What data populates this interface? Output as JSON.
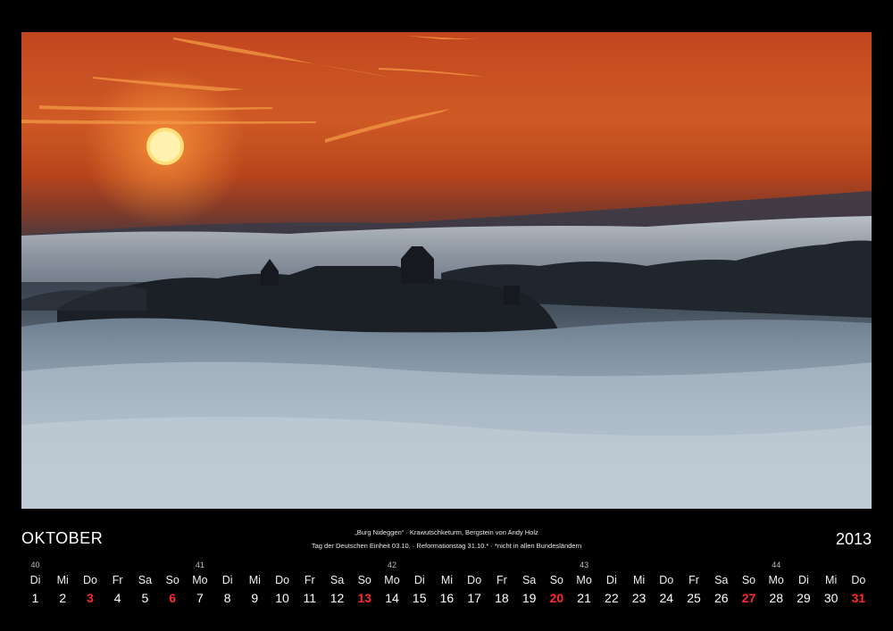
{
  "header": {
    "month": "OKTOBER",
    "year": "2013",
    "caption_line1": "„Burg Nideggen“ · Krawutschketurm, Bergstein von Andy Holz",
    "caption_line2": "Tag der Deutschen Einheit 03.10. · Reformationstag 31.10.* · *nicht in allen Bundesländern"
  },
  "photo": {
    "subject": "Burg Nideggen über dem Nebel bei Sonnenaufgang"
  },
  "colors": {
    "holiday": "#ff2a2a",
    "background": "#000000"
  },
  "calendar": {
    "weeks": [
      {
        "label": "40",
        "at_day": 0
      },
      {
        "label": "41",
        "at_day": 6
      },
      {
        "label": "42",
        "at_day": 13
      },
      {
        "label": "43",
        "at_day": 20
      },
      {
        "label": "44",
        "at_day": 27
      }
    ],
    "days": [
      {
        "name": "Di",
        "num": "1",
        "red": false
      },
      {
        "name": "Mi",
        "num": "2",
        "red": false
      },
      {
        "name": "Do",
        "num": "3",
        "red": true
      },
      {
        "name": "Fr",
        "num": "4",
        "red": false
      },
      {
        "name": "Sa",
        "num": "5",
        "red": false
      },
      {
        "name": "So",
        "num": "6",
        "red": true
      },
      {
        "name": "Mo",
        "num": "7",
        "red": false
      },
      {
        "name": "Di",
        "num": "8",
        "red": false
      },
      {
        "name": "Mi",
        "num": "9",
        "red": false
      },
      {
        "name": "Do",
        "num": "10",
        "red": false
      },
      {
        "name": "Fr",
        "num": "11",
        "red": false
      },
      {
        "name": "Sa",
        "num": "12",
        "red": false
      },
      {
        "name": "So",
        "num": "13",
        "red": true
      },
      {
        "name": "Mo",
        "num": "14",
        "red": false
      },
      {
        "name": "Di",
        "num": "15",
        "red": false
      },
      {
        "name": "Mi",
        "num": "16",
        "red": false
      },
      {
        "name": "Do",
        "num": "17",
        "red": false
      },
      {
        "name": "Fr",
        "num": "18",
        "red": false
      },
      {
        "name": "Sa",
        "num": "19",
        "red": false
      },
      {
        "name": "So",
        "num": "20",
        "red": true
      },
      {
        "name": "Mo",
        "num": "21",
        "red": false
      },
      {
        "name": "Di",
        "num": "22",
        "red": false
      },
      {
        "name": "Mi",
        "num": "23",
        "red": false
      },
      {
        "name": "Do",
        "num": "24",
        "red": false
      },
      {
        "name": "Fr",
        "num": "25",
        "red": false
      },
      {
        "name": "Sa",
        "num": "26",
        "red": false
      },
      {
        "name": "So",
        "num": "27",
        "red": true
      },
      {
        "name": "Mo",
        "num": "28",
        "red": false
      },
      {
        "name": "Di",
        "num": "29",
        "red": false
      },
      {
        "name": "Mi",
        "num": "30",
        "red": false
      },
      {
        "name": "Do",
        "num": "31",
        "red": true
      }
    ]
  }
}
